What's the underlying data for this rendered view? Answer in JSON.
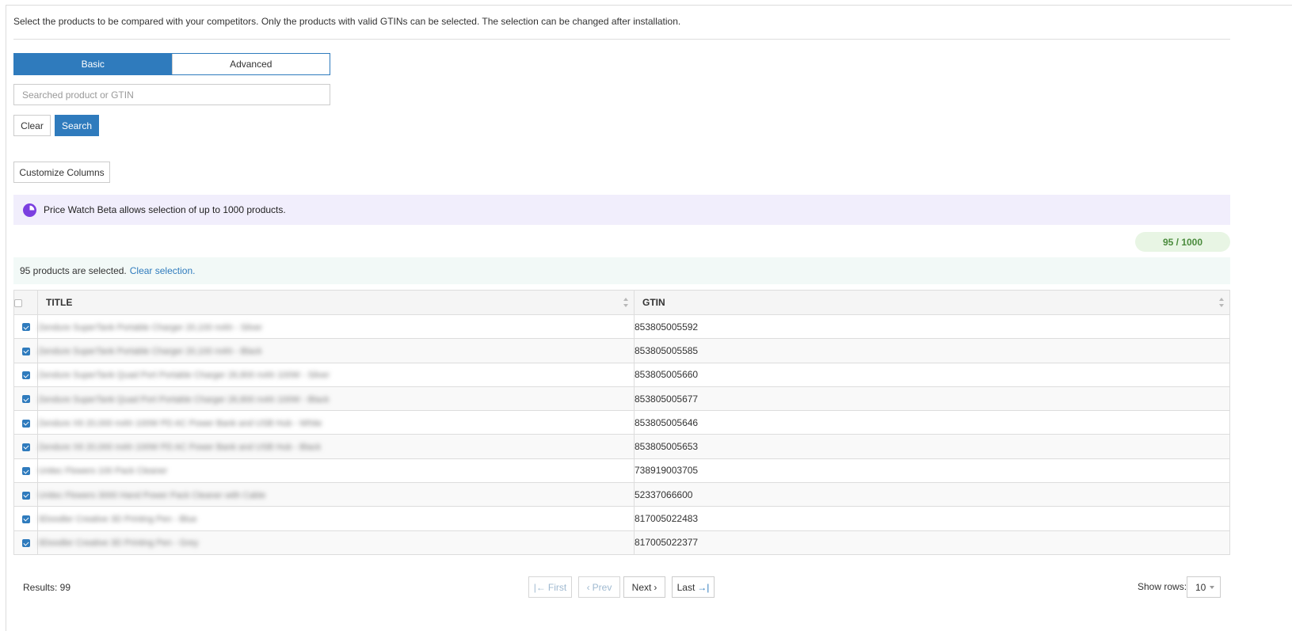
{
  "intro_text": "Select the products to be compared with your competitors. Only the products with valid GTINs can be selected. The selection can be changed after installation.",
  "tabs": [
    {
      "label": "Basic",
      "active": true
    },
    {
      "label": "Advanced",
      "active": false
    }
  ],
  "search": {
    "placeholder": "Searched product or GTIN",
    "value": ""
  },
  "buttons": {
    "clear": "Clear",
    "search": "Search",
    "customize_columns": "Customize Columns"
  },
  "notice": {
    "text": "Price Watch Beta allows selection of up to 1000 products.",
    "icon": "pie-chart-icon",
    "icon_color": "#7b3fe0"
  },
  "counter": "95 / 1000",
  "selection": {
    "text": "95 products are selected.",
    "link": "Clear selection."
  },
  "table": {
    "columns": [
      "TITLE",
      "GTIN"
    ],
    "rows": [
      {
        "title": "Zendure SuperTank Portable Charger 20,100 mAh - Silver",
        "gtin": "853805005592",
        "checked": true
      },
      {
        "title": "Zendure SuperTank Portable Charger 20,100 mAh - Black",
        "gtin": "853805005585",
        "checked": true
      },
      {
        "title": "Zendure SuperTank Quad Port Portable Charger 26,800 mAh 100W - Silver",
        "gtin": "853805005660",
        "checked": true
      },
      {
        "title": "Zendure SuperTank Quad Port Portable Charger 26,800 mAh 100W - Black",
        "gtin": "853805005677",
        "checked": true
      },
      {
        "title": "Zendure X6 20,000 mAh 100W PD AC Power Bank and USB Hub - White",
        "gtin": "853805005646",
        "checked": true
      },
      {
        "title": "Zendure X6 20,000 mAh 100W PD AC Power Bank and USB Hub - Black",
        "gtin": "853805005653",
        "checked": true
      },
      {
        "title": "Unitec Flowers 100 Pack Cleaner",
        "gtin": "738919003705",
        "checked": true
      },
      {
        "title": "Unitec Flowers 3000 Hand Power Pack Cleaner with Cable",
        "gtin": "52337066600",
        "checked": true
      },
      {
        "title": "3Doodler Creative 3D Printing Pen - Blue",
        "gtin": "817005022483",
        "checked": true
      },
      {
        "title": "3Doodler Creative 3D Printing Pen - Grey",
        "gtin": "817005022377",
        "checked": true
      }
    ]
  },
  "footer": {
    "results": "Results: 99",
    "first": "First",
    "prev": "Prev",
    "next": "Next",
    "last": "Last",
    "show_rows_label": "Show rows:",
    "rows_value": "10"
  },
  "colors": {
    "primary": "#2f7bbd",
    "counter_text": "#4a8b3c",
    "counter_bg": "#e8f5e4",
    "notice_bg": "#f1eefc"
  }
}
